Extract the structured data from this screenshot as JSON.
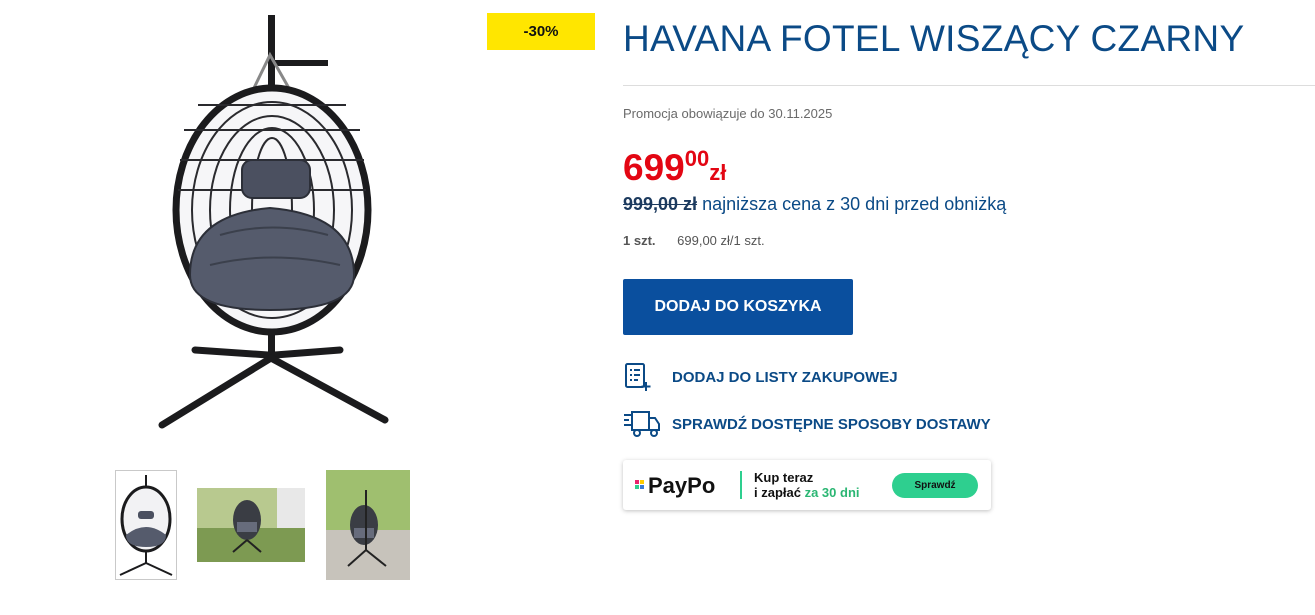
{
  "product": {
    "title": "HAVANA FOTEL WISZĄCY CZARNY",
    "discount_badge": "-30%",
    "image_name": "hanging-egg-chair",
    "thumbnails": [
      "chair-studio",
      "chair-garden",
      "chair-outdoor"
    ]
  },
  "promotion": {
    "text": "Promocja obowiązuje do 30.11.2025"
  },
  "price": {
    "integer": "699",
    "decimal": "00",
    "currency": "zł",
    "old_price": "999,00 zł",
    "old_price_note": "najniższa cena z 30 dni przed obniżką",
    "unit_qty": "1 szt.",
    "unit_price": "699,00 zł/1 szt."
  },
  "actions": {
    "add_to_cart": "DODAJ DO KOSZYKA",
    "add_to_list": "DODAJ DO LISTY ZAKUPOWEJ",
    "check_delivery": "SPRAWDŹ DOSTĘPNE SPOSOBY DOSTAWY"
  },
  "paypo": {
    "logo": "PayPo",
    "line1": "Kup teraz",
    "line2_prefix": "i zapłać",
    "line2_highlight": "za 30 dni",
    "button": "Sprawdź"
  },
  "icons": [
    "shopping-list-icon",
    "delivery-truck-icon",
    "paypo-logo-icon"
  ],
  "colors": {
    "brand_blue": "#0b4a86",
    "button_blue": "#0a4f9e",
    "price_red": "#e30613",
    "badge_yellow": "#ffe600",
    "paypo_green": "#2ecf8f"
  }
}
